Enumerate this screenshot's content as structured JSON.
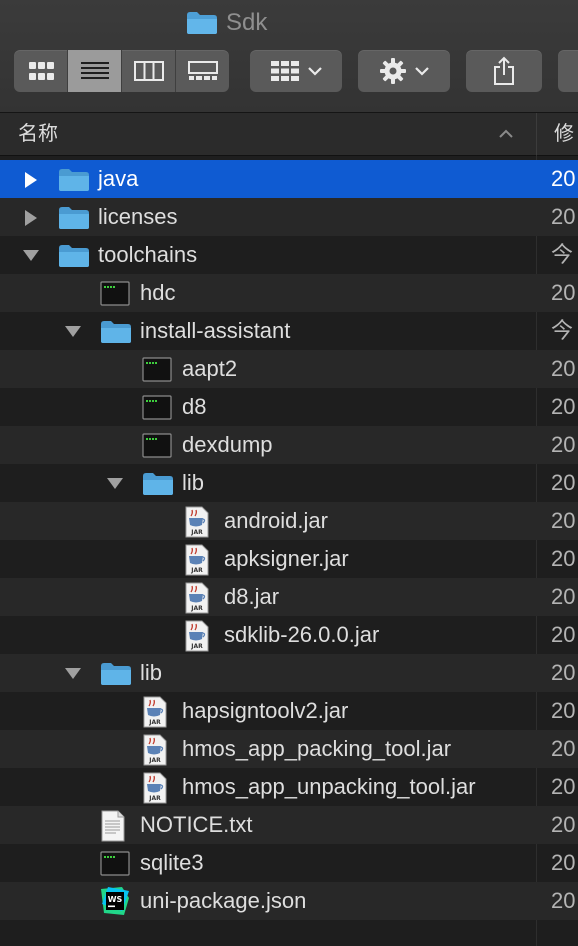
{
  "window": {
    "title": "Sdk"
  },
  "toolbar": {
    "view_modes": [
      "icon-view",
      "list-view",
      "column-view",
      "gallery-view"
    ],
    "active_view": "list-view",
    "group_button_icon": "grid-icon",
    "action_button_icon": "gear-icon",
    "share_button_icon": "share-icon"
  },
  "columns": {
    "name": "名称",
    "modified": "修"
  },
  "colors": {
    "selection": "#0f5bd2",
    "folder": "#5fb4e8"
  },
  "rows": [
    {
      "name": "java",
      "kind": "folder",
      "level": 0,
      "disclosure": "collapsed",
      "date": "20",
      "selected": true
    },
    {
      "name": "licenses",
      "kind": "folder",
      "level": 0,
      "disclosure": "collapsed",
      "date": "20"
    },
    {
      "name": "toolchains",
      "kind": "folder",
      "level": 0,
      "disclosure": "expanded",
      "date": "今"
    },
    {
      "name": "hdc",
      "kind": "executable",
      "level": 1,
      "date": "20"
    },
    {
      "name": "install-assistant",
      "kind": "folder",
      "level": 1,
      "disclosure": "expanded",
      "date": "今"
    },
    {
      "name": "aapt2",
      "kind": "executable",
      "level": 2,
      "date": "20"
    },
    {
      "name": "d8",
      "kind": "executable",
      "level": 2,
      "date": "20"
    },
    {
      "name": "dexdump",
      "kind": "executable",
      "level": 2,
      "date": "20"
    },
    {
      "name": "lib",
      "kind": "folder",
      "level": 2,
      "disclosure": "expanded",
      "date": "20"
    },
    {
      "name": "android.jar",
      "kind": "jar",
      "level": 3,
      "date": "20"
    },
    {
      "name": "apksigner.jar",
      "kind": "jar",
      "level": 3,
      "date": "20"
    },
    {
      "name": "d8.jar",
      "kind": "jar",
      "level": 3,
      "date": "20"
    },
    {
      "name": "sdklib-26.0.0.jar",
      "kind": "jar",
      "level": 3,
      "date": "20"
    },
    {
      "name": "lib",
      "kind": "folder",
      "level": 1,
      "disclosure": "expanded",
      "date": "20"
    },
    {
      "name": "hapsigntoolv2.jar",
      "kind": "jar",
      "level": 2,
      "date": "20"
    },
    {
      "name": "hmos_app_packing_tool.jar",
      "kind": "jar",
      "level": 2,
      "date": "20"
    },
    {
      "name": "hmos_app_unpacking_tool.jar",
      "kind": "jar",
      "level": 2,
      "date": "20"
    },
    {
      "name": "NOTICE.txt",
      "kind": "text",
      "level": 1,
      "date": "20"
    },
    {
      "name": "sqlite3",
      "kind": "executable",
      "level": 1,
      "date": "20"
    },
    {
      "name": "uni-package.json",
      "kind": "webstorm",
      "level": 1,
      "date": "20"
    }
  ]
}
